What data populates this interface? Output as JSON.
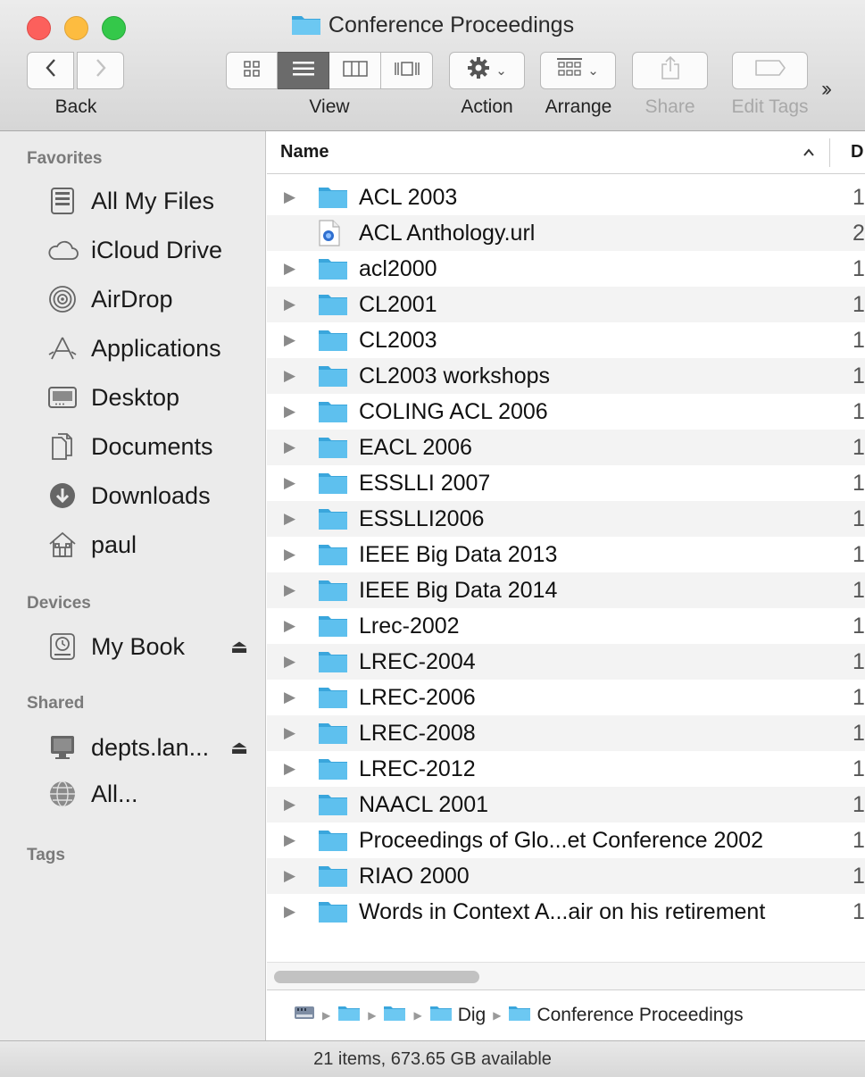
{
  "window": {
    "title": "Conference Proceedings"
  },
  "toolbar": {
    "back_label": "Back",
    "view_label": "View",
    "action_label": "Action",
    "arrange_label": "Arrange",
    "share_label": "Share",
    "edit_tags_label": "Edit Tags",
    "active_view": "list"
  },
  "sidebar": {
    "favorites_header": "Favorites",
    "favorites": [
      {
        "label": "All My Files",
        "icon": "all-my-files-icon"
      },
      {
        "label": "iCloud Drive",
        "icon": "cloud-icon"
      },
      {
        "label": "AirDrop",
        "icon": "airdrop-icon"
      },
      {
        "label": "Applications",
        "icon": "applications-icon"
      },
      {
        "label": "Desktop",
        "icon": "desktop-icon"
      },
      {
        "label": "Documents",
        "icon": "documents-icon"
      },
      {
        "label": "Downloads",
        "icon": "downloads-icon"
      },
      {
        "label": "paul",
        "icon": "home-icon"
      }
    ],
    "devices_header": "Devices",
    "devices": [
      {
        "label": "My Book",
        "icon": "time-machine-drive-icon"
      }
    ],
    "shared_header": "Shared",
    "shared": [
      {
        "label": "depts.lan...",
        "icon": "display-icon"
      },
      {
        "label": "All...",
        "icon": "network-globe-icon"
      }
    ],
    "tags_header": "Tags"
  },
  "list": {
    "name_header": "Name",
    "date_header_partial": "D",
    "rows": [
      {
        "name": "ACL 2003",
        "type": "folder",
        "date_partial": "1"
      },
      {
        "name": "ACL Anthology.url",
        "type": "url",
        "date_partial": "2"
      },
      {
        "name": "acl2000",
        "type": "folder",
        "date_partial": "1"
      },
      {
        "name": "CL2001",
        "type": "folder",
        "date_partial": "1"
      },
      {
        "name": "CL2003",
        "type": "folder",
        "date_partial": "1"
      },
      {
        "name": "CL2003 workshops",
        "type": "folder",
        "date_partial": "1"
      },
      {
        "name": "COLING ACL 2006",
        "type": "folder",
        "date_partial": "1"
      },
      {
        "name": "EACL 2006",
        "type": "folder",
        "date_partial": "1"
      },
      {
        "name": "ESSLLI 2007",
        "type": "folder",
        "date_partial": "1"
      },
      {
        "name": "ESSLLI2006",
        "type": "folder",
        "date_partial": "1"
      },
      {
        "name": "IEEE Big Data 2013",
        "type": "folder",
        "date_partial": "1"
      },
      {
        "name": "IEEE Big Data 2014",
        "type": "folder",
        "date_partial": "1"
      },
      {
        "name": "Lrec-2002",
        "type": "folder",
        "date_partial": "1"
      },
      {
        "name": "LREC-2004",
        "type": "folder",
        "date_partial": "1"
      },
      {
        "name": "LREC-2006",
        "type": "folder",
        "date_partial": "1"
      },
      {
        "name": "LREC-2008",
        "type": "folder",
        "date_partial": "1"
      },
      {
        "name": "LREC-2012",
        "type": "folder",
        "date_partial": "1"
      },
      {
        "name": "NAACL 2001",
        "type": "folder",
        "date_partial": "1"
      },
      {
        "name": "Proceedings of Glo...et Conference 2002",
        "type": "folder",
        "date_partial": "1"
      },
      {
        "name": "RIAO 2000",
        "type": "folder",
        "date_partial": "1"
      },
      {
        "name": "Words in Context A...air on his retirement",
        "type": "folder",
        "date_partial": "1"
      }
    ]
  },
  "pathbar": {
    "partial_segment": "Dig",
    "current": "Conference Proceedings"
  },
  "status": {
    "text": "21 items, 673.65 GB available"
  },
  "colors": {
    "folder": "#5ec0ee",
    "folder_dark": "#3aa6dc",
    "row_alt": "#f3f3f3",
    "sidebar_bg": "#ebebeb"
  }
}
